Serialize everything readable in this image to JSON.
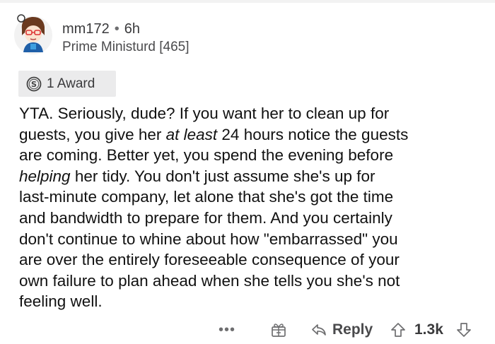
{
  "comment": {
    "username": "mm172",
    "separator": "•",
    "age": "6h",
    "flair": "Prime Ministurd [465]",
    "award": {
      "icon": "silver-award-icon",
      "label": "1 Award"
    },
    "body_lines": [
      [
        {
          "t": "YTA. Seriously, dude? If you want her to clean up for"
        }
      ],
      [
        {
          "t": "guests, you give her "
        },
        {
          "t": "at least",
          "em": true
        },
        {
          "t": " 24 hours notice the guests"
        }
      ],
      [
        {
          "t": "are coming. Better yet, you spend the evening before"
        }
      ],
      [
        {
          "t": "helping",
          "em": true
        },
        {
          "t": " her tidy. You don't just assume she's up for"
        }
      ],
      [
        {
          "t": "last-minute company, let alone that she's got the time"
        }
      ],
      [
        {
          "t": "and bandwidth to prepare for them. And you certainly"
        }
      ],
      [
        {
          "t": "don't continue to whine about how \"embarrassed\" you"
        }
      ],
      [
        {
          "t": "are over the entirely foreseeable consequence of your"
        }
      ],
      [
        {
          "t": "own failure to plan ahead when she tells you she's not"
        }
      ],
      [
        {
          "t": "feeling well."
        }
      ]
    ],
    "actions": {
      "more": "•••",
      "gift_icon": "gift-icon",
      "reply_icon": "reply-arrow-icon",
      "reply_label": "Reply",
      "upvote_icon": "upvote-arrow-icon",
      "score": "1.3k",
      "downvote_icon": "downvote-arrow-icon"
    }
  },
  "colors": {
    "text": "#111111",
    "meta": "#3a3a3c",
    "award_bg": "#ebebec"
  }
}
